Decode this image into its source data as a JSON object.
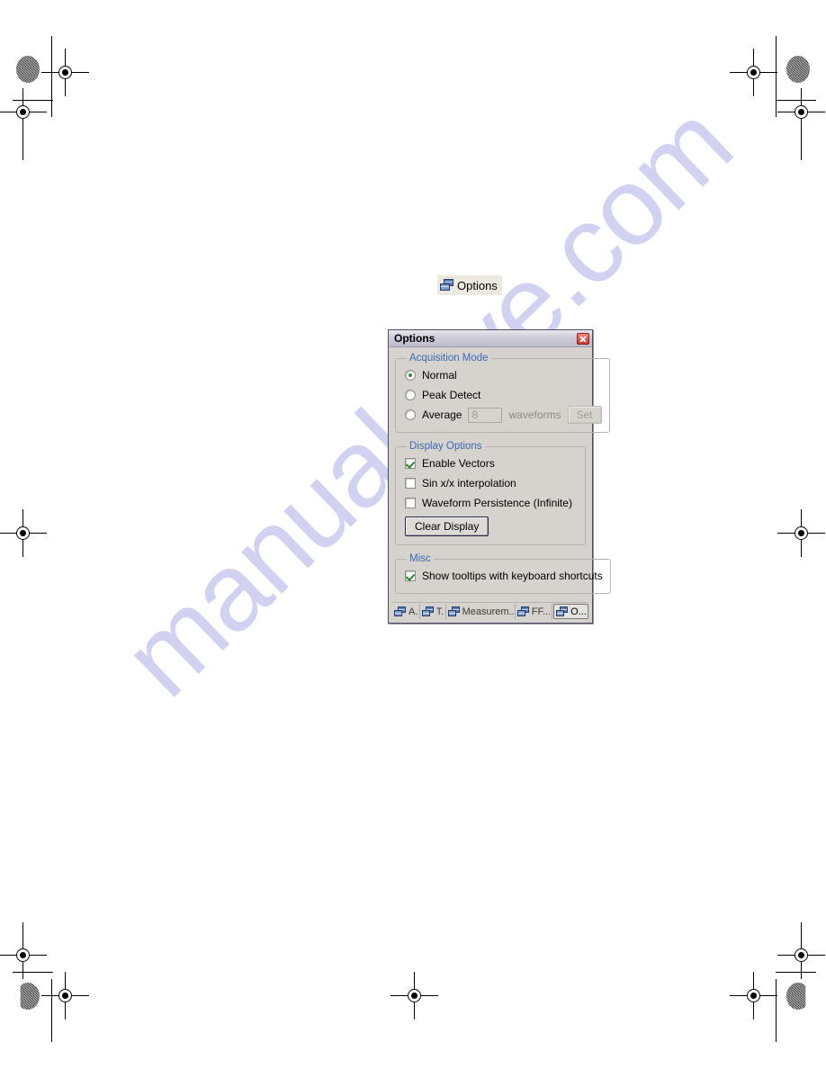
{
  "page": {
    "background": "#ffffff",
    "watermark_text": "manualslive.com",
    "watermark_color": "#c9c9ef"
  },
  "toolbar_button": {
    "label": "Options",
    "icon": "cascade-windows-icon"
  },
  "dialog": {
    "title": "Options",
    "close_label": "Close",
    "groups": [
      {
        "legend": "Acquisition Mode",
        "controls": [
          {
            "type": "radio",
            "label": "Normal",
            "checked": true,
            "enabled": true
          },
          {
            "type": "radio",
            "label": "Peak Detect",
            "checked": false,
            "enabled": true
          },
          {
            "type": "radio",
            "label": "Average",
            "checked": false,
            "enabled": true
          }
        ],
        "average_field_value": "8",
        "average_units_label": "waveforms",
        "average_set_button": "Set"
      },
      {
        "legend": "Display Options",
        "controls": [
          {
            "type": "checkbox",
            "label": "Enable Vectors",
            "checked": true
          },
          {
            "type": "checkbox",
            "label": "Sin x/x interpolation",
            "checked": false
          },
          {
            "type": "checkbox",
            "label": "Waveform Persistence (Infinite)",
            "checked": false
          }
        ],
        "clear_display_button": "Clear Display"
      },
      {
        "legend": "Misc",
        "controls": [
          {
            "type": "checkbox",
            "label": "Show tooltips with keyboard shortcuts",
            "checked": true
          }
        ]
      }
    ],
    "taskbar": [
      {
        "label": "A.",
        "active": false
      },
      {
        "label": "T.",
        "active": false
      },
      {
        "label": "Measurem..",
        "active": false
      },
      {
        "label": "FF...",
        "active": false
      },
      {
        "label": "O...",
        "active": true
      }
    ],
    "colors": {
      "legend_text": "#3e68b5",
      "dialog_face": "#d6d3ce",
      "close_button": "#e2564a",
      "check_mark": "#1f8a2b"
    }
  }
}
